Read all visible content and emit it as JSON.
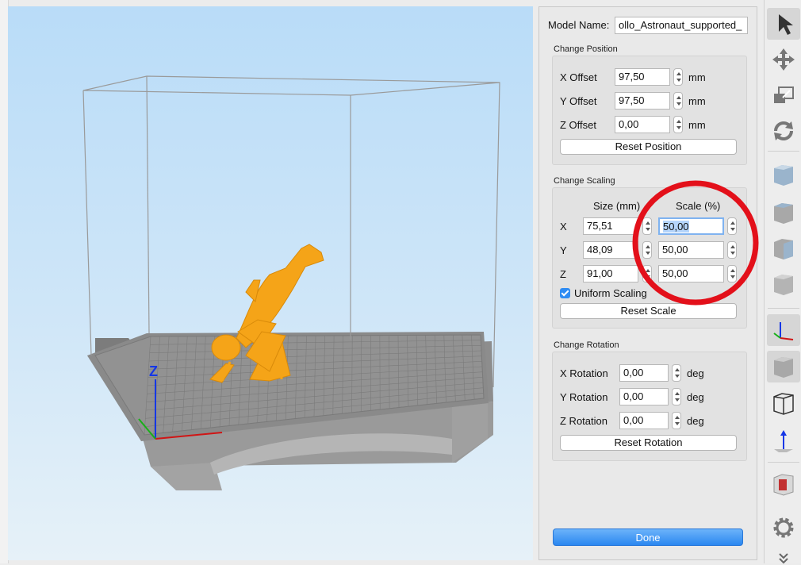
{
  "model_name_label": "Model Name:",
  "model_name_value": "ollo_Astronaut_supported_",
  "position": {
    "title": "Change Position",
    "x_label": "X Offset",
    "x_value": "97,50",
    "y_label": "Y Offset",
    "y_value": "97,50",
    "z_label": "Z Offset",
    "z_value": "0,00",
    "unit": "mm",
    "reset_label": "Reset Position"
  },
  "scaling": {
    "title": "Change Scaling",
    "size_header": "Size (mm)",
    "scale_header": "Scale (%)",
    "x_label": "X",
    "x_size": "75,51",
    "x_scale": "50,00",
    "y_label": "Y",
    "y_size": "48,09",
    "y_scale": "50,00",
    "z_label": "Z",
    "z_size": "91,00",
    "z_scale": "50,00",
    "uniform_label": "Uniform Scaling",
    "uniform_checked": true,
    "reset_label": "Reset Scale"
  },
  "rotation": {
    "title": "Change Rotation",
    "x_label": "X Rotation",
    "x_value": "0,00",
    "y_label": "Y Rotation",
    "y_value": "0,00",
    "z_label": "Z Rotation",
    "z_value": "0,00",
    "unit": "deg",
    "reset_label": "Reset Rotation"
  },
  "done_label": "Done",
  "viewport": {
    "axis_z_label": "Z"
  },
  "toolbar": [
    "select-tool-icon",
    "move-tool-icon",
    "scale-tool-icon",
    "rotate-tool-icon",
    "view-front-icon",
    "view-top-icon",
    "view-side-icon",
    "view-iso-icon",
    "axes-toggle-icon",
    "solid-view-icon",
    "wireframe-view-icon",
    "z-axis-icon",
    "cut-view-icon",
    "settings-icon"
  ],
  "colors": {
    "model": "#f5a418",
    "highlight_circle": "#e3101a",
    "done_button": "#2a87f0",
    "viewport_top": "#b9dcf8"
  }
}
